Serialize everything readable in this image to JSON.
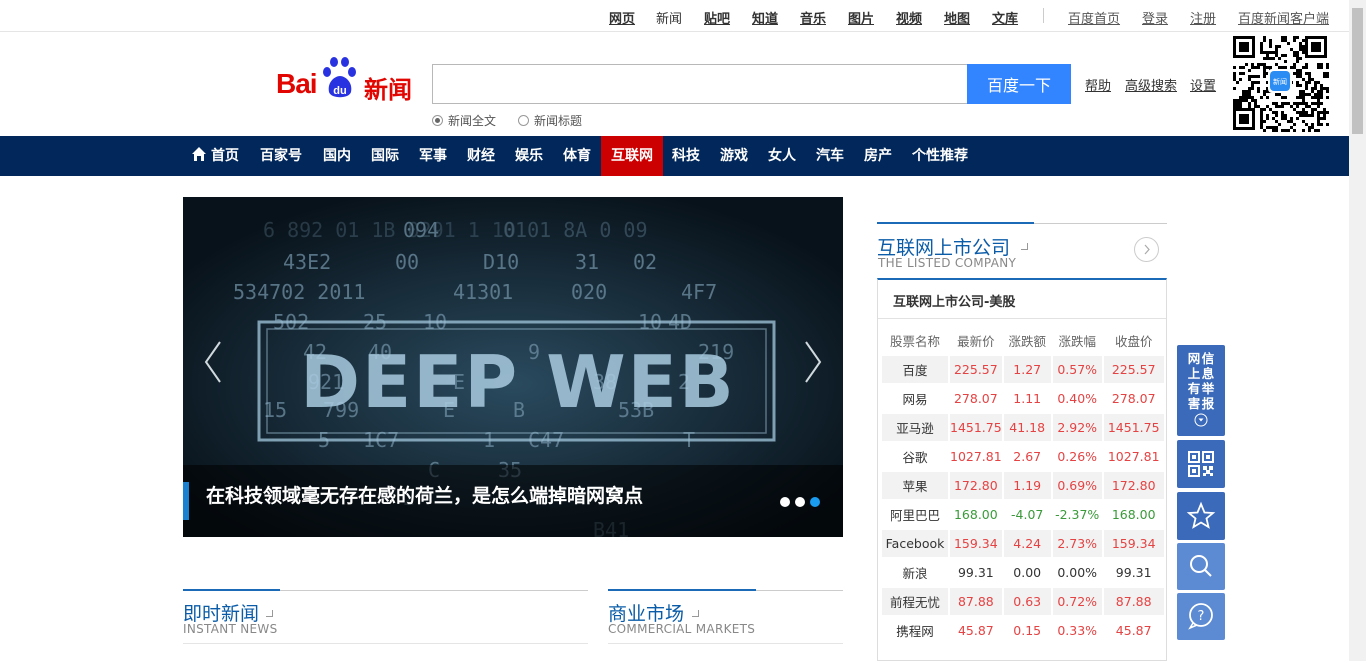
{
  "topnav": {
    "items": [
      "网页",
      "新闻",
      "贴吧",
      "知道",
      "音乐",
      "图片",
      "视频",
      "地图",
      "文库"
    ],
    "right": [
      "百度首页",
      "登录",
      "注册",
      "百度新闻客户端"
    ]
  },
  "logo": {
    "bai": "Bai",
    "du": "du",
    "news": "新闻"
  },
  "search": {
    "value": "",
    "button": "百度一下",
    "help": "帮助",
    "advanced": "高级搜索",
    "settings": "设置",
    "options": [
      "新闻全文",
      "新闻标题"
    ],
    "selected": "新闻全文"
  },
  "qr": {
    "badge": "新闻"
  },
  "mainnav": {
    "home": "首页",
    "items": [
      "百家号",
      "国内",
      "国际",
      "军事",
      "财经",
      "娱乐",
      "体育",
      "互联网",
      "科技",
      "游戏",
      "女人",
      "汽车",
      "房产",
      "个性推荐"
    ],
    "active": "互联网"
  },
  "slide": {
    "caption": "在科技领域毫无存在感的荷兰，是怎么端掉暗网窝点",
    "image_text": "DEEP WEB",
    "dots": 3,
    "active_dot": 3
  },
  "sections": {
    "instant": {
      "title": "即时新闻",
      "sub": "INSTANT NEWS"
    },
    "commercial": {
      "title": "商业市场",
      "sub": "COMMERCIAL MARKETS"
    },
    "listed": {
      "title": "互联网上市公司",
      "sub": "THE LISTED COMPANY"
    }
  },
  "stocks": {
    "heading": "互联网上市公司-美股",
    "columns": [
      "股票名称",
      "最新价",
      "涨跌额",
      "涨跌幅",
      "收盘价"
    ],
    "rows": [
      {
        "name": "百度",
        "price": "225.57",
        "change": "1.27",
        "pct": "0.57%",
        "close": "225.57",
        "trend": "up"
      },
      {
        "name": "网易",
        "price": "278.07",
        "change": "1.11",
        "pct": "0.40%",
        "close": "278.07",
        "trend": "up"
      },
      {
        "name": "亚马逊",
        "price": "1451.75",
        "change": "41.18",
        "pct": "2.92%",
        "close": "1451.75",
        "trend": "up"
      },
      {
        "name": "谷歌",
        "price": "1027.81",
        "change": "2.67",
        "pct": "0.26%",
        "close": "1027.81",
        "trend": "up"
      },
      {
        "name": "苹果",
        "price": "172.80",
        "change": "1.19",
        "pct": "0.69%",
        "close": "172.80",
        "trend": "up"
      },
      {
        "name": "阿里巴巴",
        "price": "168.00",
        "change": "-4.07",
        "pct": "-2.37%",
        "close": "168.00",
        "trend": "down"
      },
      {
        "name": "Facebook",
        "price": "159.34",
        "change": "4.24",
        "pct": "2.73%",
        "close": "159.34",
        "trend": "up"
      },
      {
        "name": "新浪",
        "price": "99.31",
        "change": "0.00",
        "pct": "0.00%",
        "close": "99.31",
        "trend": "flat"
      },
      {
        "name": "前程无忧",
        "price": "87.88",
        "change": "0.63",
        "pct": "0.72%",
        "close": "87.88",
        "trend": "up"
      },
      {
        "name": "携程网",
        "price": "45.87",
        "change": "0.15",
        "pct": "0.33%",
        "close": "45.87",
        "trend": "up"
      }
    ]
  },
  "sidebar": {
    "report": "网上有害信息举报"
  },
  "colors": {
    "nav_bg": "#01275b",
    "active": "#cc0000",
    "accent_blue": "#3385ff",
    "up": "#e54343",
    "down": "#3a9a3a"
  }
}
